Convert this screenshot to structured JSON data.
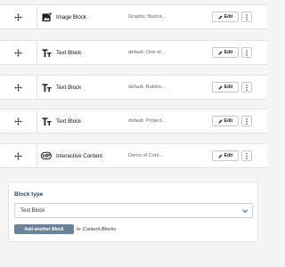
{
  "blocks": [
    {
      "type_label": "Image Block",
      "summary": "Graphic Illustra...",
      "icon": "image-icon",
      "edit_label": "Edit"
    },
    {
      "type_label": "Text Block",
      "summary": "default. One of...",
      "icon": "text-icon",
      "edit_label": "Edit"
    },
    {
      "type_label": "Text Block",
      "summary": "default. Buildin...",
      "icon": "text-icon",
      "edit_label": "Edit"
    },
    {
      "type_label": "Text Block",
      "summary": "default. Project...",
      "icon": "text-icon",
      "edit_label": "Edit"
    },
    {
      "type_label": "Interactive Content",
      "summary": "Demo of Cont...",
      "icon": "h5p-icon",
      "edit_label": "Edit"
    }
  ],
  "add_block": {
    "label": "Block type",
    "selected_type": "Text Block",
    "button_label": "Add another Block",
    "to_text": "to",
    "target": "Content Blocks"
  },
  "colors": {
    "accent_label": "#214a7a",
    "button_bg": "#6a8398",
    "select_chevron": "#2a7bd1"
  }
}
